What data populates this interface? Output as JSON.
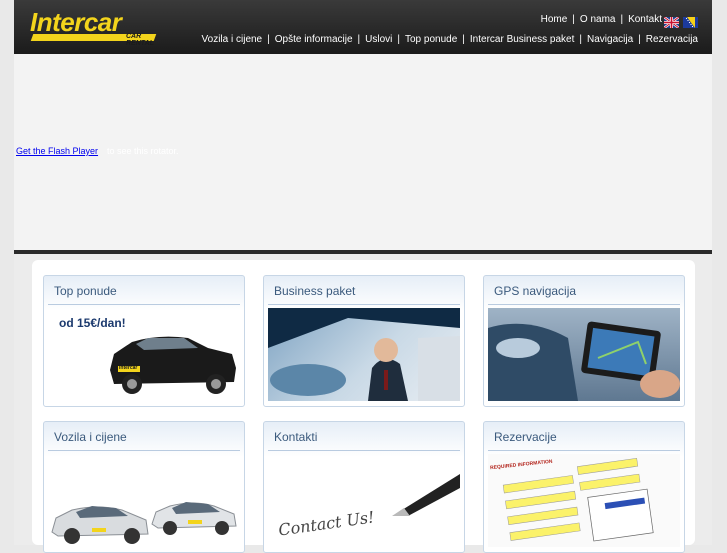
{
  "logo": {
    "name": "Intercar",
    "subtitle": "CAR RENTAL"
  },
  "top_nav": [
    {
      "label": "Home"
    },
    {
      "label": "O nama"
    },
    {
      "label": "Kontakt"
    }
  ],
  "main_nav": [
    {
      "label": "Vozila i cijene"
    },
    {
      "label": "Opšte informacije"
    },
    {
      "label": "Uslovi"
    },
    {
      "label": "Top ponude"
    },
    {
      "label": "Intercar Business paket"
    },
    {
      "label": "Navigacija"
    },
    {
      "label": "Rezervacija"
    }
  ],
  "separator": "|",
  "flags": [
    "uk-flag-icon",
    "bih-flag-icon"
  ],
  "flash": {
    "link_text": "Get the Flash Player",
    "rest_text": "to see this rotator."
  },
  "boxes": [
    {
      "title": "Top ponude",
      "promo": "od 15€/dan!",
      "car_badge": "intercar"
    },
    {
      "title": "Business paket"
    },
    {
      "title": "GPS navigacija"
    },
    {
      "title": "Vozila i cijene"
    },
    {
      "title": "Kontakti",
      "handwriting": "Contact Us!"
    },
    {
      "title": "Rezervacije",
      "form_header": "REQUIRED INFORMATION"
    }
  ],
  "colors": {
    "logo_yellow": "#f3d41c",
    "box_title": "#3b5a7d",
    "header_dark": "#1b1b1b"
  }
}
